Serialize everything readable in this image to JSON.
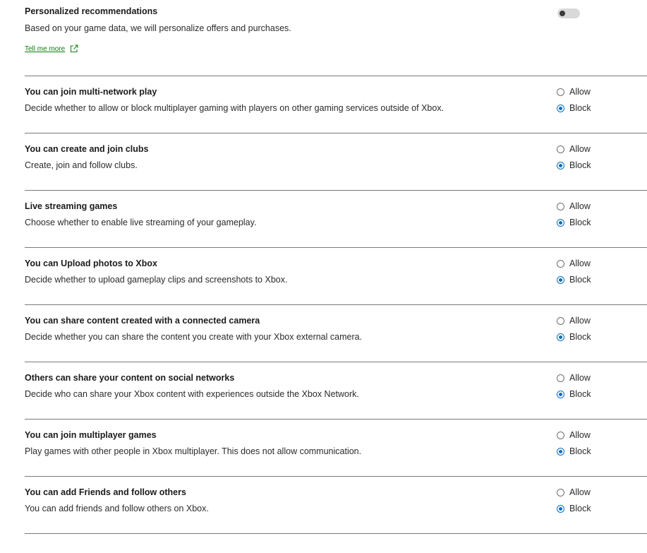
{
  "personalized": {
    "title": "Personalized recommendations",
    "description": "Based on your game data, we will personalize offers and purchases.",
    "link_label": "Tell me more",
    "toggle_on": false
  },
  "options": {
    "allow": "Allow",
    "block": "Block"
  },
  "settings": [
    {
      "title": "You can join multi-network play",
      "description": "Decide whether to allow or block multiplayer gaming with players on other gaming services outside of Xbox.",
      "selected": "Block"
    },
    {
      "title": "You can create and join clubs",
      "description": "Create, join and follow clubs.",
      "selected": "Block"
    },
    {
      "title": "Live streaming games",
      "description": "Choose whether to enable live streaming of your gameplay.",
      "selected": "Block"
    },
    {
      "title": "You can Upload photos to Xbox",
      "description": "Decide whether to upload gameplay clips and screenshots to Xbox.",
      "selected": "Block"
    },
    {
      "title": "You can share content created with a connected camera",
      "description": "Decide whether you can share the content you create with your Xbox external camera.",
      "selected": "Block"
    },
    {
      "title": "Others can share your content on social networks",
      "description": "Decide who can share your Xbox content with experiences outside the Xbox Network.",
      "selected": "Block"
    },
    {
      "title": "You can join multiplayer games",
      "description": "Play games with other people in Xbox multiplayer. This does not allow communication.",
      "selected": "Block"
    },
    {
      "title": "You can add Friends and follow others",
      "description": "You can add friends and follow others on Xbox.",
      "selected": "Block"
    }
  ],
  "colors": {
    "accent": "#0f6cbd",
    "link": "#107c10",
    "divider": "#7a7a7a"
  }
}
